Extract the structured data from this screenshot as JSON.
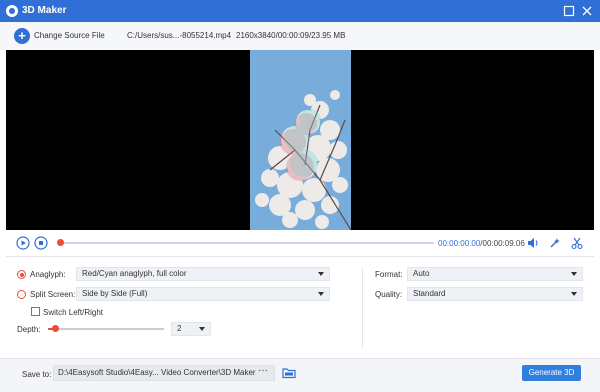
{
  "window": {
    "title": "3D Maker",
    "accent": "#2f6fd6",
    "icons": {
      "app": "app-logo-icon",
      "maximize": "maximize-icon",
      "close": "close-icon"
    }
  },
  "source": {
    "change_label": "Change Source File",
    "file_path": "C:/Users/sus...-8055214.mp4",
    "file_meta": "2160x3840/00:00:09/23.95 MB"
  },
  "player": {
    "current_time": "00:00:00.00",
    "separator": "/",
    "total_time": "00:00:09.06",
    "progress": 0,
    "icons": [
      "play-icon",
      "stop-icon",
      "volume-icon",
      "effects-icon",
      "cut-icon"
    ]
  },
  "settings": {
    "anaglyph": {
      "label": "Anaglyph:",
      "selected": true,
      "value": "Red/Cyan anaglyph, full color"
    },
    "split_screen": {
      "label": "Split Screen:",
      "selected": false,
      "value": "Side by Side (Full)"
    },
    "switch_lr": {
      "label": "Switch Left/Right",
      "checked": false
    },
    "depth": {
      "label": "Depth:",
      "value": "2"
    },
    "format": {
      "label": "Format:",
      "value": "Auto"
    },
    "quality": {
      "label": "Quality:",
      "value": "Standard"
    },
    "accent": "#e74c3c"
  },
  "footer": {
    "save_label": "Save to:",
    "save_path": "D:\\4Easysoft Studio\\4Easy... Video Converter\\3D Maker",
    "dots": "···",
    "generate_label": "Generate 3D",
    "button_color": "#2f7fe0"
  }
}
